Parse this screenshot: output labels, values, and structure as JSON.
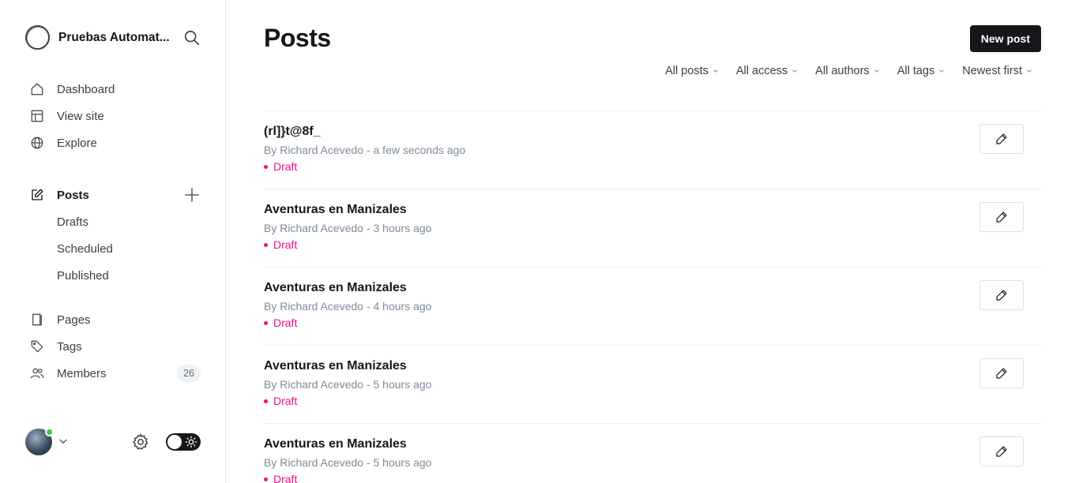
{
  "brand": {
    "name": "Pruebas Automat...",
    "icon": "site-logo"
  },
  "nav": {
    "dashboard": "Dashboard",
    "view_site": "View site",
    "explore": "Explore",
    "posts": "Posts",
    "drafts": "Drafts",
    "scheduled": "Scheduled",
    "published": "Published",
    "pages": "Pages",
    "tags": "Tags",
    "members": "Members",
    "members_count": "26"
  },
  "header": {
    "title": "Posts",
    "new_post": "New post"
  },
  "filters": {
    "type": "All posts",
    "access": "All access",
    "authors": "All authors",
    "tags": "All tags",
    "order": "Newest first"
  },
  "posts": [
    {
      "title": "(rl]}t@8f_",
      "meta": "By Richard Acevedo - a few seconds ago",
      "status": "Draft"
    },
    {
      "title": "Aventuras en Manizales",
      "meta": "By Richard Acevedo - 3 hours ago",
      "status": "Draft"
    },
    {
      "title": "Aventuras en Manizales",
      "meta": "By Richard Acevedo - 4 hours ago",
      "status": "Draft"
    },
    {
      "title": "Aventuras en Manizales",
      "meta": "By Richard Acevedo - 5 hours ago",
      "status": "Draft"
    },
    {
      "title": "Aventuras en Manizales",
      "meta": "By Richard Acevedo - 5 hours ago",
      "status": "Draft"
    }
  ],
  "colors": {
    "accent_draft": "#f50b84",
    "primary_button": "#15171a",
    "online_indicator": "#30cf43"
  }
}
